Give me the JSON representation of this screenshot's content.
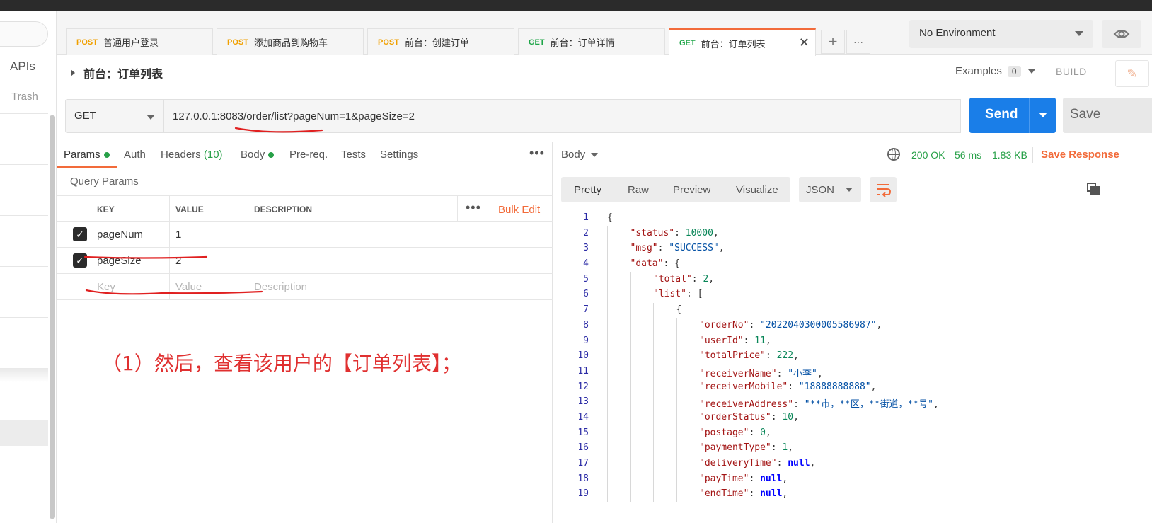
{
  "sidebar": {
    "apis_label": "APIs",
    "trash_label": "Trash"
  },
  "tabs": [
    {
      "method": "POST",
      "name": "普通用户登录"
    },
    {
      "method": "POST",
      "name": "添加商品到购物车"
    },
    {
      "method": "POST",
      "name": "前台：创建订单"
    },
    {
      "method": "GET",
      "name": "前台：订单详情"
    },
    {
      "method": "GET",
      "name": "前台：订单列表",
      "active": true
    }
  ],
  "tab_controls": {
    "new_tab": "+",
    "more": "···",
    "close": "✕"
  },
  "environment": {
    "selected": "No Environment"
  },
  "request": {
    "title": "前台：订单列表",
    "examples_label": "Examples",
    "examples_count": "0",
    "build_label": "BUILD",
    "method": "GET",
    "url": "127.0.0.1:8083/order/list?pageNum=1&pageSize=2",
    "send_label": "Send",
    "save_label": "Save"
  },
  "request_tabs": {
    "params": "Params",
    "auth": "Auth",
    "headers": "Headers",
    "headers_count": "(10)",
    "body": "Body",
    "prereq": "Pre-req.",
    "tests": "Tests",
    "settings": "Settings"
  },
  "query_params": {
    "label": "Query Params",
    "headers": {
      "key": "KEY",
      "value": "VALUE",
      "description": "DESCRIPTION"
    },
    "bulk_edit": "Bulk Edit",
    "rows": [
      {
        "key": "pageNum",
        "value": "1",
        "checked": true
      },
      {
        "key": "pageSize",
        "value": "2",
        "checked": true
      }
    ],
    "placeholders": {
      "key": "Key",
      "value": "Value",
      "description": "Description"
    }
  },
  "annotation": "（1）然后，查看该用户的【订单列表】；",
  "response": {
    "body_label": "Body",
    "status": "200 OK",
    "time": "56 ms",
    "size": "1.83 KB",
    "save_response": "Save Response",
    "views": [
      "Pretty",
      "Raw",
      "Preview",
      "Visualize"
    ],
    "format": "JSON",
    "lines": [
      {
        "n": "1",
        "indent": 0,
        "parts": [
          [
            "p",
            "{"
          ]
        ]
      },
      {
        "n": "2",
        "indent": 1,
        "parts": [
          [
            "k",
            "\"status\""
          ],
          [
            "p",
            ": "
          ],
          [
            "n",
            "10000"
          ],
          [
            "p",
            ","
          ]
        ]
      },
      {
        "n": "3",
        "indent": 1,
        "parts": [
          [
            "k",
            "\"msg\""
          ],
          [
            "p",
            ": "
          ],
          [
            "s",
            "\"SUCCESS\""
          ],
          [
            "p",
            ","
          ]
        ]
      },
      {
        "n": "4",
        "indent": 1,
        "parts": [
          [
            "k",
            "\"data\""
          ],
          [
            "p",
            ": {"
          ]
        ]
      },
      {
        "n": "5",
        "indent": 2,
        "parts": [
          [
            "k",
            "\"total\""
          ],
          [
            "p",
            ": "
          ],
          [
            "n",
            "2"
          ],
          [
            "p",
            ","
          ]
        ]
      },
      {
        "n": "6",
        "indent": 2,
        "parts": [
          [
            "k",
            "\"list\""
          ],
          [
            "p",
            ": ["
          ]
        ]
      },
      {
        "n": "7",
        "indent": 3,
        "parts": [
          [
            "p",
            "{"
          ]
        ]
      },
      {
        "n": "8",
        "indent": 4,
        "parts": [
          [
            "k",
            "\"orderNo\""
          ],
          [
            "p",
            ": "
          ],
          [
            "s",
            "\"2022040300005586987\""
          ],
          [
            "p",
            ","
          ]
        ]
      },
      {
        "n": "9",
        "indent": 4,
        "parts": [
          [
            "k",
            "\"userId\""
          ],
          [
            "p",
            ": "
          ],
          [
            "n",
            "11"
          ],
          [
            "p",
            ","
          ]
        ]
      },
      {
        "n": "10",
        "indent": 4,
        "parts": [
          [
            "k",
            "\"totalPrice\""
          ],
          [
            "p",
            ": "
          ],
          [
            "n",
            "222"
          ],
          [
            "p",
            ","
          ]
        ]
      },
      {
        "n": "11",
        "indent": 4,
        "parts": [
          [
            "k",
            "\"receiverName\""
          ],
          [
            "p",
            ": "
          ],
          [
            "s",
            "\"小李\""
          ],
          [
            "p",
            ","
          ]
        ]
      },
      {
        "n": "12",
        "indent": 4,
        "parts": [
          [
            "k",
            "\"receiverMobile\""
          ],
          [
            "p",
            ": "
          ],
          [
            "s",
            "\"18888888888\""
          ],
          [
            "p",
            ","
          ]
        ]
      },
      {
        "n": "13",
        "indent": 4,
        "parts": [
          [
            "k",
            "\"receiverAddress\""
          ],
          [
            "p",
            ": "
          ],
          [
            "s",
            "\"**市，**区，**街道，**号\""
          ],
          [
            "p",
            ","
          ]
        ]
      },
      {
        "n": "14",
        "indent": 4,
        "parts": [
          [
            "k",
            "\"orderStatus\""
          ],
          [
            "p",
            ": "
          ],
          [
            "n",
            "10"
          ],
          [
            "p",
            ","
          ]
        ]
      },
      {
        "n": "15",
        "indent": 4,
        "parts": [
          [
            "k",
            "\"postage\""
          ],
          [
            "p",
            ": "
          ],
          [
            "n",
            "0"
          ],
          [
            "p",
            ","
          ]
        ]
      },
      {
        "n": "16",
        "indent": 4,
        "parts": [
          [
            "k",
            "\"paymentType\""
          ],
          [
            "p",
            ": "
          ],
          [
            "n",
            "1"
          ],
          [
            "p",
            ","
          ]
        ]
      },
      {
        "n": "17",
        "indent": 4,
        "parts": [
          [
            "k",
            "\"deliveryTime\""
          ],
          [
            "p",
            ": "
          ],
          [
            "kw",
            "null"
          ],
          [
            "p",
            ","
          ]
        ]
      },
      {
        "n": "18",
        "indent": 4,
        "parts": [
          [
            "k",
            "\"payTime\""
          ],
          [
            "p",
            ": "
          ],
          [
            "kw",
            "null"
          ],
          [
            "p",
            ","
          ]
        ]
      },
      {
        "n": "19",
        "indent": 4,
        "parts": [
          [
            "k",
            "\"endTime\""
          ],
          [
            "p",
            ": "
          ],
          [
            "kw",
            "null"
          ],
          [
            "p",
            ","
          ]
        ]
      }
    ]
  },
  "colors": {
    "accent": "#f26b3a",
    "send": "#1a7ee8",
    "post": "#f0a000",
    "get": "#1ea548",
    "annotation": "#e03030"
  }
}
